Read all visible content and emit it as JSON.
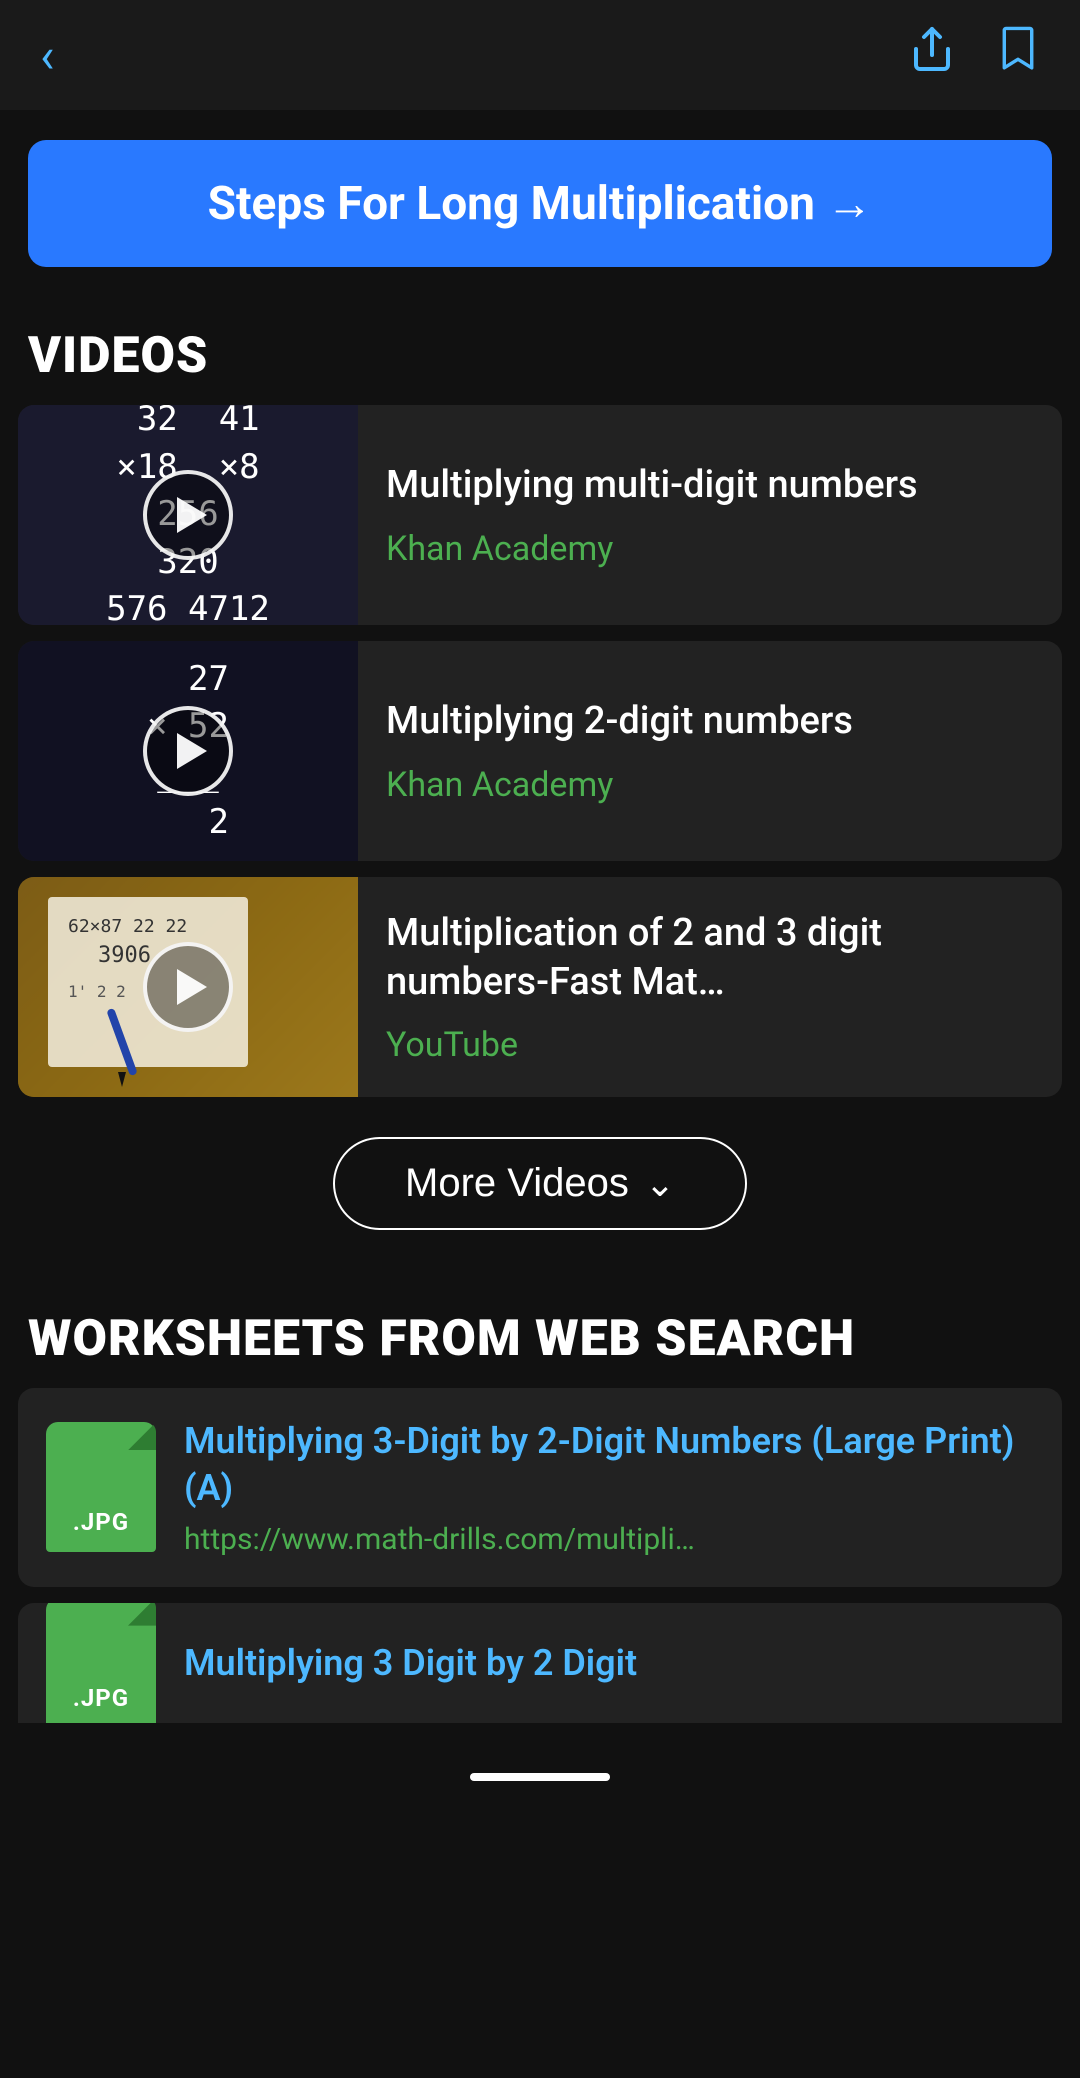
{
  "topBar": {
    "backIcon": "←",
    "shareIcon": "⬆",
    "bookmarkIcon": "🔖"
  },
  "ctaBanner": {
    "text": "Steps For Long Multiplication →"
  },
  "videosSection": {
    "header": "VIDEOS",
    "videos": [
      {
        "id": "video-1",
        "title": "Multiplying multi-digit numbers",
        "source": "Khan Academy",
        "thumbType": "math1",
        "mathLines": [
          "32   41",
          "×18  ×8",
          "256  ",
          "320  ",
          "576  4712"
        ]
      },
      {
        "id": "video-2",
        "title": "Multiplying 2-digit numbers",
        "source": "Khan Academy",
        "thumbType": "math2",
        "mathLines": [
          "27",
          "× 52",
          "_2"
        ]
      },
      {
        "id": "video-3",
        "title": "Multiplication of 2 and 3 digit numbers-Fast Mat…",
        "source": "YouTube",
        "thumbType": "real"
      }
    ],
    "moreVideosBtn": "More Videos"
  },
  "worksheetsSection": {
    "header": "WORKSHEETS FROM WEB SEARCH",
    "worksheets": [
      {
        "id": "ws-1",
        "fileType": ".JPG",
        "title": "Multiplying 3-Digit by 2-Digit Numbers (Large Print) (A)",
        "url": "https://www.math-drills.com/multipli…"
      },
      {
        "id": "ws-2",
        "fileType": ".JPG",
        "title": "Multiplying 3 Digit by 2 Digit",
        "url": ""
      }
    ]
  }
}
